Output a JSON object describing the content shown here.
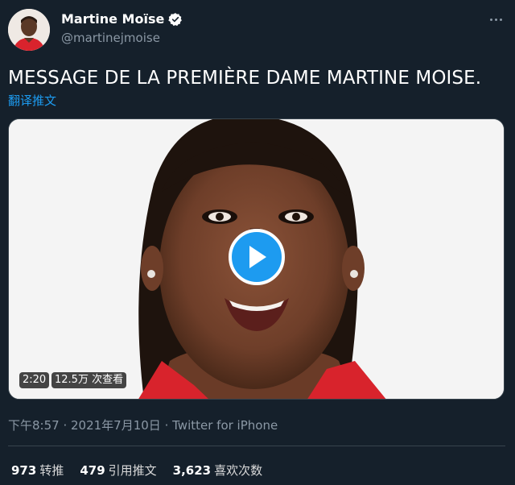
{
  "author": {
    "name": "Martine Moïse",
    "handle": "@martinejmoise",
    "verified": true
  },
  "tweet": {
    "text": "MESSAGE DE LA PREMIÈRE DAME MARTINE MOISE.",
    "translate_label": "翻译推文"
  },
  "video": {
    "duration": "2:20",
    "views": "12.5万 次查看"
  },
  "meta": {
    "time": "下午8:57",
    "date": "2021年7月10日",
    "source": "Twitter for iPhone",
    "separator": " · "
  },
  "stats": {
    "retweets_count": "973",
    "retweets_label": "转推",
    "quotes_count": "479",
    "quotes_label": "引用推文",
    "likes_count": "3,623",
    "likes_label": "喜欢次数"
  },
  "colors": {
    "background": "#15202b",
    "accent": "#1d9bf0",
    "secondary_text": "#8b98a5",
    "divider": "#38444d"
  },
  "icons": [
    "verified-badge-icon",
    "more-options-icon",
    "play-icon"
  ]
}
